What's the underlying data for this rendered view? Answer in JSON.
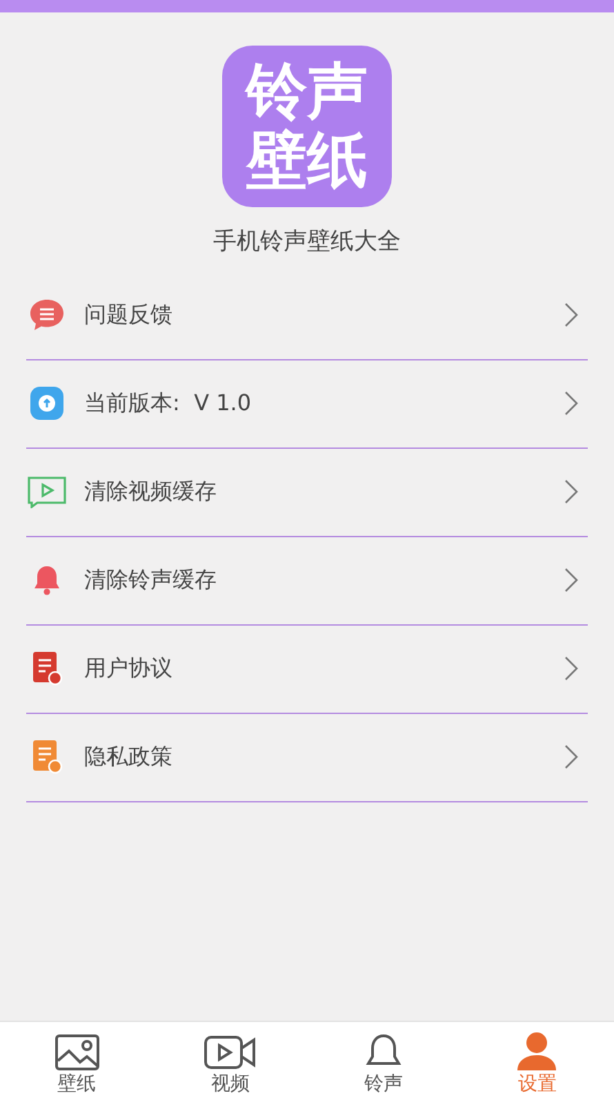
{
  "logo": {
    "lines": [
      "铃声",
      "壁纸"
    ]
  },
  "app_name": "手机铃声壁纸大全",
  "menu": [
    {
      "kind": "feedback",
      "label": "问题反馈"
    },
    {
      "kind": "version",
      "label": "当前版本:  V 1.0"
    },
    {
      "kind": "video",
      "label": "清除视频缓存"
    },
    {
      "kind": "bell",
      "label": "清除铃声缓存"
    },
    {
      "kind": "agreement",
      "label": "用户协议"
    },
    {
      "kind": "privacy",
      "label": "隐私政策"
    }
  ],
  "tabs": [
    {
      "kind": "wallpaper",
      "label": "壁纸",
      "selected": false
    },
    {
      "kind": "video",
      "label": "视频",
      "selected": false
    },
    {
      "kind": "ringtone",
      "label": "铃声",
      "selected": false
    },
    {
      "kind": "settings",
      "label": "设置",
      "selected": true
    }
  ]
}
